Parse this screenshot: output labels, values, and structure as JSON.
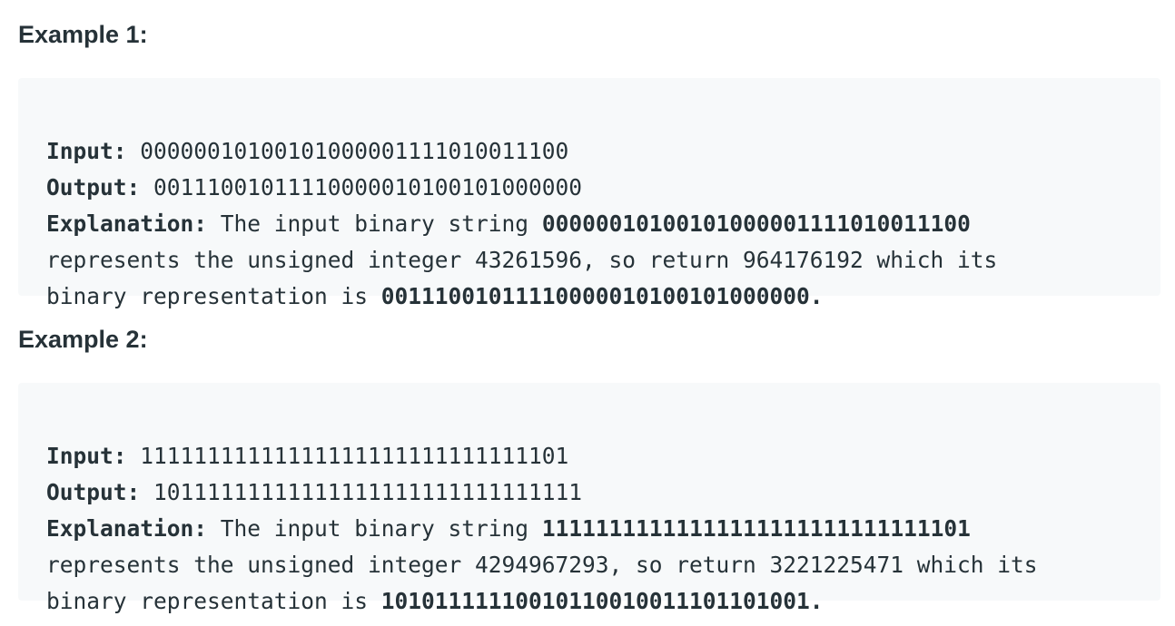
{
  "examples": [
    {
      "heading": "Example 1:",
      "input_label": "Input:",
      "input_value": "00000010100101000001111010011100",
      "output_label": "Output:",
      "output_value": "00111001011110000010100101000000",
      "explanation_label": "Explanation:",
      "explanation_prefix": "The input binary string",
      "explanation_input": "00000010100101000001111010011100",
      "explanation_line2": "represents the unsigned integer 43261596, so return 964176192 which its",
      "explanation_line3_prefix": "binary representation is",
      "explanation_output": "00111001011110000010100101000000."
    },
    {
      "heading": "Example 2:",
      "input_label": "Input:",
      "input_value": "11111111111111111111111111111101",
      "output_label": "Output:",
      "output_value": "10111111111111111111111111111111",
      "explanation_label": "Explanation:",
      "explanation_prefix": "The input binary string",
      "explanation_input": "11111111111111111111111111111101",
      "explanation_line2": "represents the unsigned integer 4294967293, so return 3221225471 which its",
      "explanation_line3_prefix": "binary representation is",
      "explanation_output": "10101111110010110010011101101001."
    }
  ]
}
